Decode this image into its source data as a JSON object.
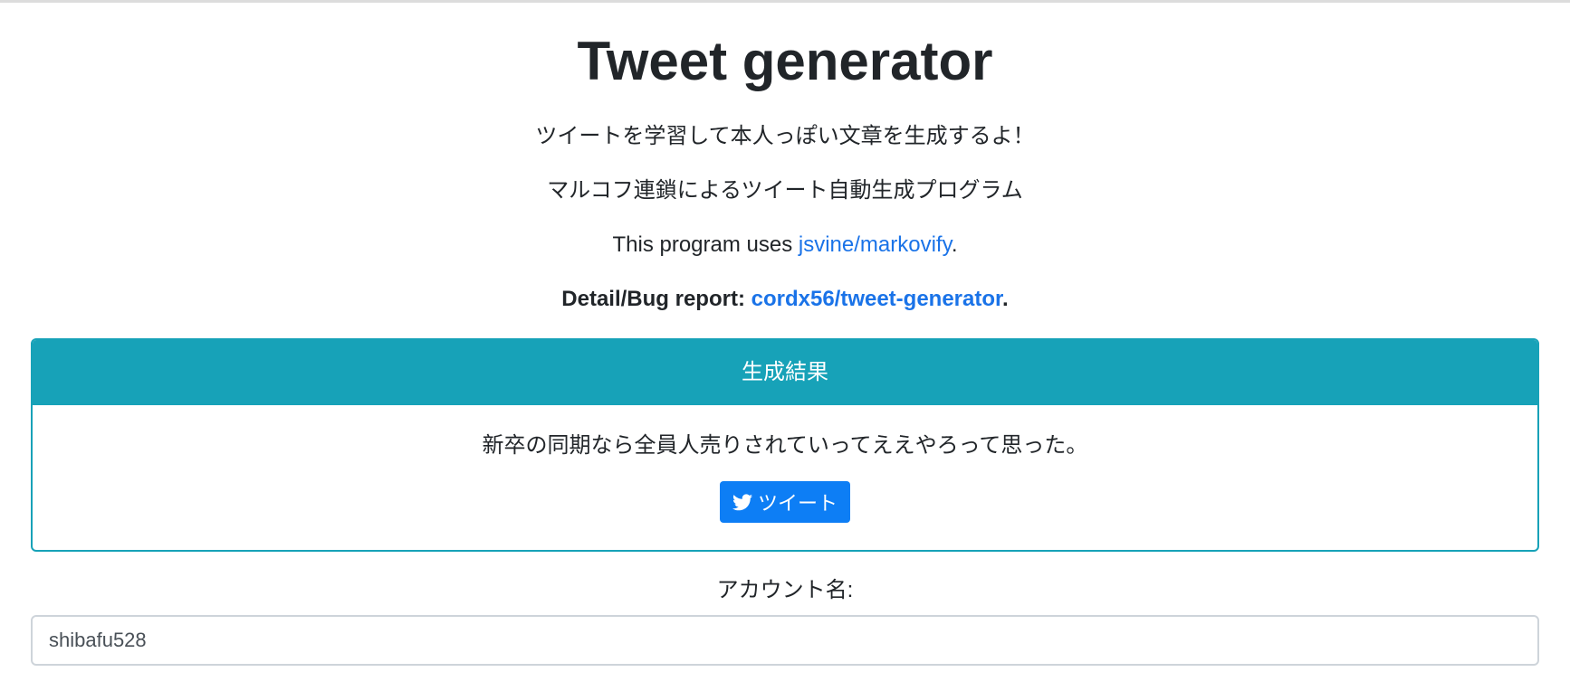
{
  "page": {
    "title": "Tweet generator",
    "subtitle_1": "ツイートを学習して本人っぽい文章を生成するよ！",
    "subtitle_2": "マルコフ連鎖によるツイート自動生成プログラム",
    "uses_prefix": "This program uses ",
    "uses_link": "jsvine/markovify",
    "uses_suffix": ".",
    "detail_prefix": "Detail/Bug report: ",
    "detail_link": "cordx56/tweet-generator",
    "detail_suffix": "."
  },
  "result_card": {
    "header": "生成結果",
    "text": "新卒の同期なら全員人売りされていってええやろって思った。",
    "tweet_button_label": "ツイート",
    "tweet_button_icon": "twitter-bird-icon"
  },
  "account_form": {
    "label": "アカウント名:",
    "value": "shibafu528"
  },
  "colors": {
    "accent": "#17a2b8",
    "link": "#1a73e8",
    "button": "#0d7ef5"
  }
}
